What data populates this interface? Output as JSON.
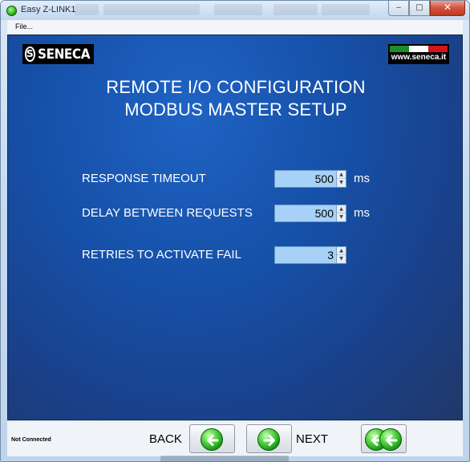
{
  "window": {
    "title": "Easy Z-LINK1",
    "controls": {
      "minimize": "‒",
      "maximize": "□",
      "close": "✕"
    }
  },
  "menu": {
    "file": "File..."
  },
  "logos": {
    "brand_mark": "S",
    "brand_word": "SENECA",
    "website": "www.seneca.it"
  },
  "header": {
    "title_line1": "REMOTE I/O CONFIGURATION",
    "title_line2": "MODBUS MASTER SETUP"
  },
  "fields": [
    {
      "label": "RESPONSE TIMEOUT",
      "value": "500",
      "unit": "ms"
    },
    {
      "label": "DELAY BETWEEN REQUESTS",
      "value": "500",
      "unit": "ms"
    },
    {
      "label": "RETRIES TO ACTIVATE FAIL",
      "value": "3",
      "unit": ""
    }
  ],
  "footer": {
    "status": "Not Connected",
    "back_label": "BACK",
    "next_label": "NEXT"
  },
  "icons": {
    "title": "app-icon",
    "back": "arrow-left-icon",
    "next": "arrow-right-icon",
    "first": "double-arrow-left-icon"
  },
  "colors": {
    "content_bg": "#1650a8",
    "spin_bg": "#a8d1f7",
    "nav_icon": "#1e9e18"
  }
}
